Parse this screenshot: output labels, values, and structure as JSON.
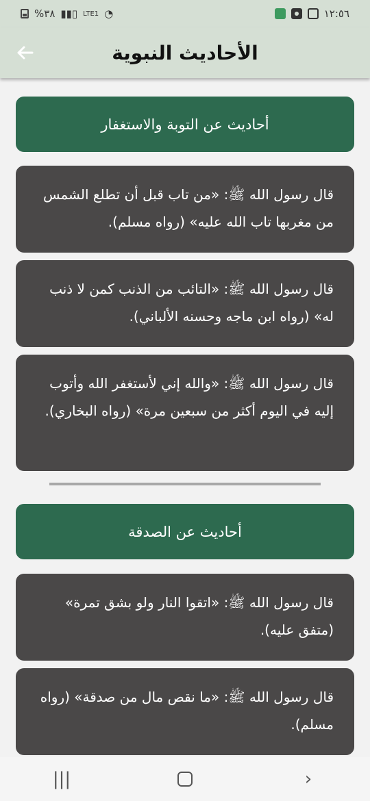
{
  "status_bar": {
    "time": "١٢:٥٦",
    "battery": "%٣٨",
    "network": "LTE1"
  },
  "header": {
    "title": "الأحاديث النبوية",
    "back_icon": "arrow-left-icon"
  },
  "sections": [
    {
      "title": "أحاديث عن التوبة والاستغفار",
      "hadiths": [
        "قال رسول الله ﷺ: «من تاب قبل أن تطلع الشمس من مغربها تاب الله عليه» (رواه مسلم).",
        "قال رسول الله ﷺ: «التائب من الذنب كمن لا ذنب له» (رواه ابن ماجه وحسنه الألباني).",
        "قال رسول الله ﷺ: «والله إني لأستغفر الله وأتوب إليه في اليوم أكثر من سبعين مرة» (رواه البخاري)."
      ]
    },
    {
      "title": "أحاديث عن الصدقة",
      "hadiths": [
        "قال رسول الله ﷺ: «اتقوا النار ولو بشق تمرة» (متفق عليه).",
        "قال رسول الله ﷺ: «ما نقص مال من صدقة» (رواه مسلم)."
      ]
    }
  ],
  "nav_bar": {
    "recents_icon": "recents-icon",
    "home_icon": "home-icon",
    "back_icon": "back-chevron-icon"
  },
  "colors": {
    "header_bg": "#d5dfd4",
    "section_header": "#2d6a4f",
    "card_bg": "#4a4848",
    "page_bg": "#f2f2f2"
  }
}
